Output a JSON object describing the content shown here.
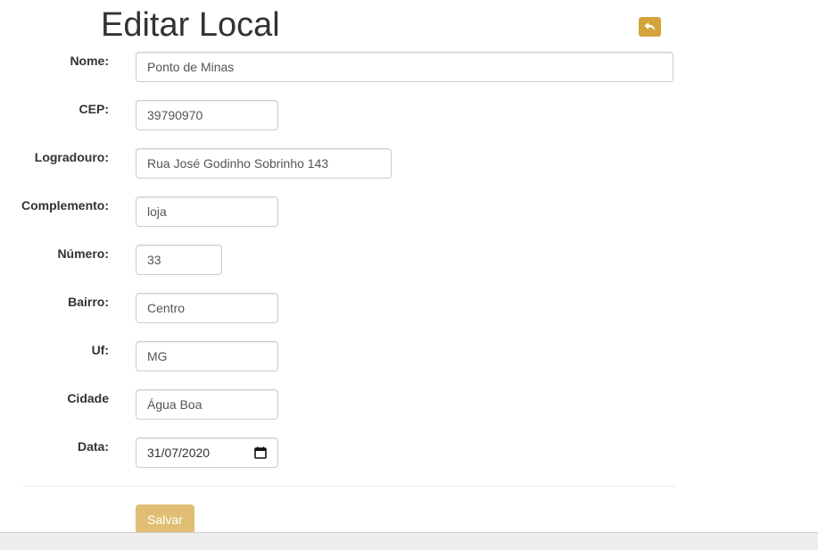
{
  "header": {
    "title": "Editar Local"
  },
  "form": {
    "nome": {
      "label": "Nome:",
      "value": "Ponto de Minas"
    },
    "cep": {
      "label": "CEP:",
      "value": "39790970"
    },
    "logradouro": {
      "label": "Logradouro:",
      "value": "Rua José Godinho Sobrinho 143"
    },
    "complemento": {
      "label": "Complemento:",
      "value": "loja"
    },
    "numero": {
      "label": "Número:",
      "value": "33"
    },
    "bairro": {
      "label": "Bairro:",
      "value": "Centro"
    },
    "uf": {
      "label": "Uf:",
      "value": "MG"
    },
    "cidade": {
      "label": "Cidade",
      "value": "Água Boa"
    },
    "data": {
      "label": "Data:",
      "value": "31/07/2020"
    }
  },
  "actions": {
    "save_label": "Salvar"
  },
  "icons": {
    "back": "reply-arrow-icon",
    "calendar": "calendar-icon"
  },
  "colors": {
    "accent": "#d4a43a",
    "save_button": "#e0bf74"
  }
}
